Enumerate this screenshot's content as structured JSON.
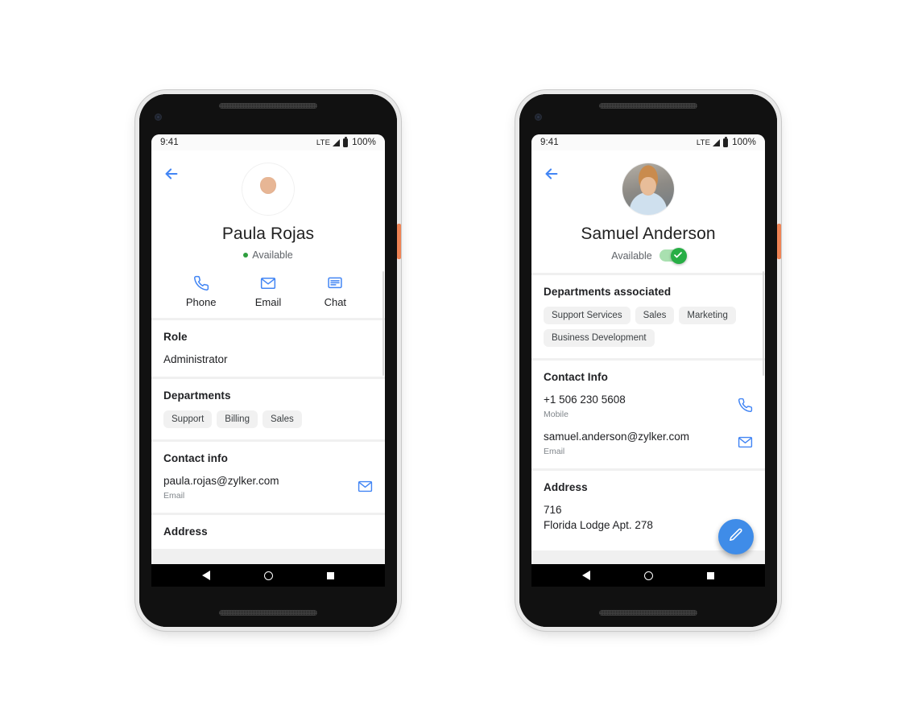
{
  "phones": [
    {
      "id": "left",
      "status_bar": {
        "time": "9:41",
        "network": "LTE",
        "battery": "100%"
      },
      "back_icon": "back-arrow-icon",
      "profile": {
        "name": "Paula Rojas",
        "availability": "Available",
        "availability_style": "dot",
        "dot_color": "#2e9e3e"
      },
      "actions": [
        {
          "label": "Phone",
          "icon": "phone-icon"
        },
        {
          "label": "Email",
          "icon": "envelope-icon"
        },
        {
          "label": "Chat",
          "icon": "chat-icon"
        }
      ],
      "sections": [
        {
          "kind": "value",
          "title": "Role",
          "value": "Administrator"
        },
        {
          "kind": "chips",
          "title": "Departments",
          "chips": [
            "Support",
            "Billing",
            "Sales"
          ]
        },
        {
          "kind": "contacts",
          "title": "Contact info",
          "rows": [
            {
              "value": "paula.rojas@zylker.com",
              "sub": "Email",
              "icon": "envelope-icon"
            }
          ]
        },
        {
          "kind": "address",
          "title": "Address",
          "lines": []
        }
      ],
      "nav": {
        "back": "nav-back-icon",
        "home": "nav-home-icon",
        "recent": "nav-recent-icon"
      },
      "fab": null
    },
    {
      "id": "right",
      "status_bar": {
        "time": "9:41",
        "network": "LTE",
        "battery": "100%"
      },
      "back_icon": "back-arrow-icon",
      "profile": {
        "name": "Samuel Anderson",
        "availability": "Available",
        "availability_style": "toggle",
        "toggle_on": true,
        "toggle_color": "#27ae45"
      },
      "actions": [],
      "sections": [
        {
          "kind": "chips",
          "title": "Departments associated",
          "chips": [
            "Support Services",
            "Sales",
            "Marketing",
            "Business Development"
          ]
        },
        {
          "kind": "contacts",
          "title": "Contact Info",
          "rows": [
            {
              "value": "+1 506 230 5608",
              "sub": "Mobile",
              "icon": "phone-icon"
            },
            {
              "value": "samuel.anderson@zylker.com",
              "sub": "Email",
              "icon": "envelope-icon"
            }
          ]
        },
        {
          "kind": "address",
          "title": "Address",
          "lines": [
            "716",
            "Florida Lodge Apt. 278"
          ]
        }
      ],
      "nav": {
        "back": "nav-back-icon",
        "home": "nav-home-icon",
        "recent": "nav-recent-icon"
      },
      "fab": {
        "icon": "pencil-icon",
        "color": "#3f8ce8"
      }
    }
  ],
  "theme": {
    "accent_blue": "#4285f4",
    "chip_bg": "#f1f1f1",
    "page_bg": "#ffffff",
    "card_bg": "#ffffff",
    "divider": "#f0f0f0",
    "power_button": "#ef8354"
  }
}
